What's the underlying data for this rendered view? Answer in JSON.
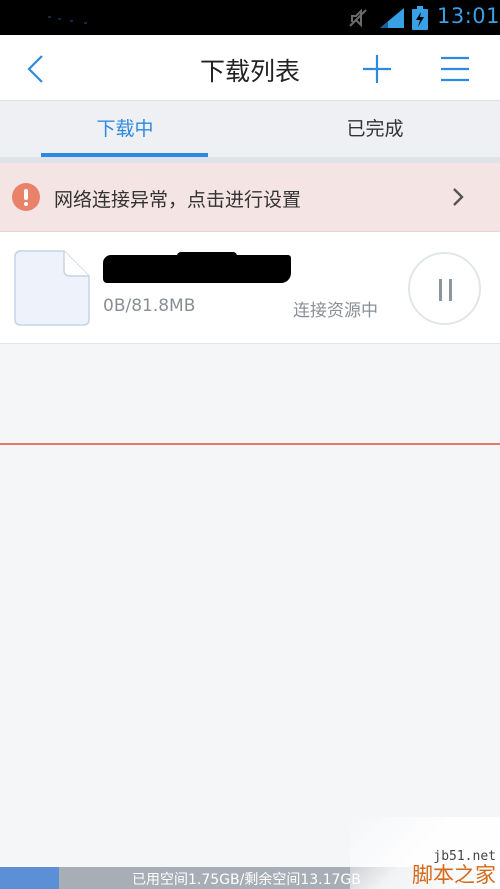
{
  "status_bar": {
    "time": "13:01",
    "icons": [
      "mute-icon",
      "signal-icon",
      "battery-charging-icon"
    ],
    "accent": "#3aa0e6"
  },
  "header": {
    "title": "下载列表",
    "back_icon": "chevron-left-icon",
    "add_icon": "plus-icon",
    "menu_icon": "hamburger-menu-icon"
  },
  "tabs": [
    {
      "label": "下载中",
      "active": true
    },
    {
      "label": "已完成",
      "active": false
    }
  ],
  "alert": {
    "text": "网络连接异常，点击进行设置",
    "icon": "exclamation-circle-icon",
    "bg": "#f5e4e4",
    "icon_color": "#e8836a"
  },
  "downloads": [
    {
      "name": "",
      "size": "0B/81.8MB",
      "status": "连接资源中",
      "icon": "file-icon",
      "action_icon": "pause-icon"
    }
  ],
  "footer": {
    "storage_text": "已用空间1.75GB/剩余空间13.17GB",
    "used_fraction": 0.117
  },
  "watermark": {
    "site": "jb51.net",
    "name": "脚本之家"
  },
  "colors": {
    "primary": "#2d8ae0",
    "alert_red": "#e57a6a"
  }
}
